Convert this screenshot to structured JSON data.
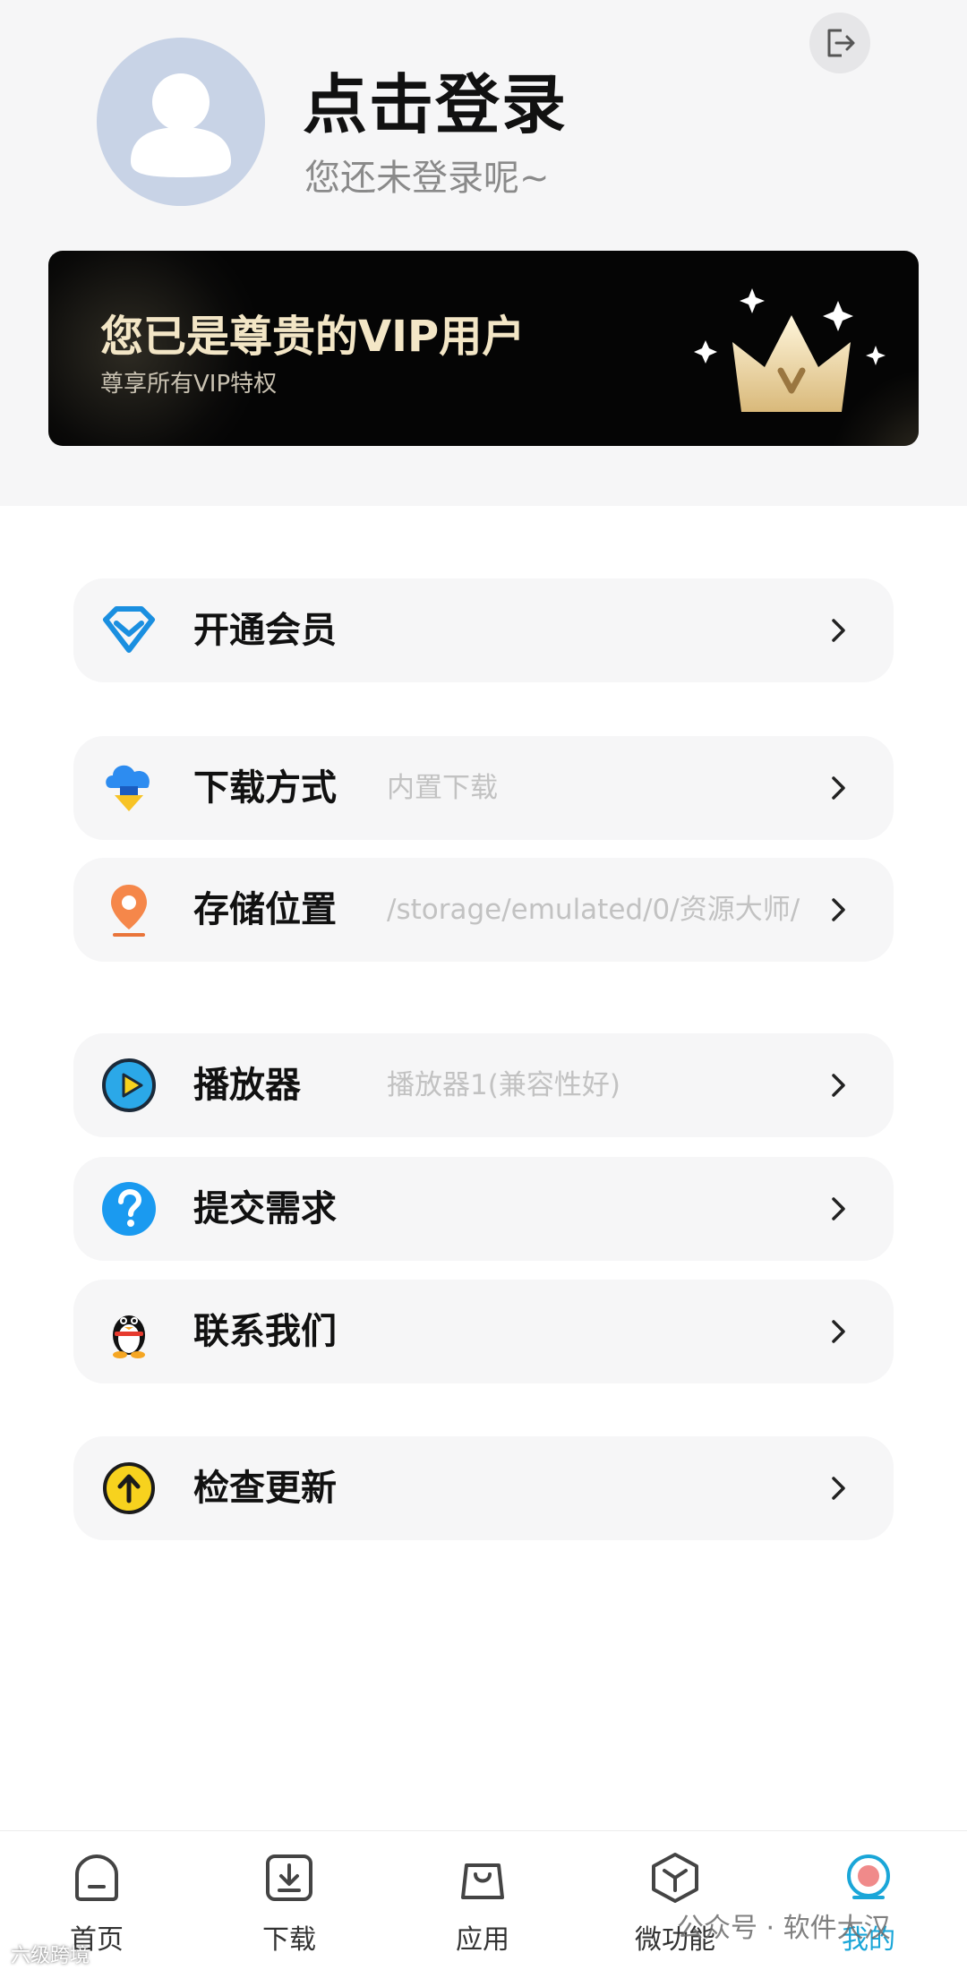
{
  "header": {
    "login_title": "点击登录",
    "login_subtitle": "您还未登录呢~"
  },
  "vip_banner": {
    "title": "您已是尊贵的VIP用户",
    "subtitle": "尊享所有VIP特权"
  },
  "menu": [
    {
      "label": "开通会员",
      "value": "",
      "icon": "diamond-icon"
    },
    {
      "label": "下载方式",
      "value": "内置下载",
      "icon": "cloud-download-icon"
    },
    {
      "label": "存储位置",
      "value": "/storage/emulated/0/资源大师/",
      "icon": "location-pin-icon"
    },
    {
      "label": "播放器",
      "value": "播放器1(兼容性好)",
      "icon": "play-icon"
    },
    {
      "label": "提交需求",
      "value": "",
      "icon": "question-icon"
    },
    {
      "label": "联系我们",
      "value": "",
      "icon": "qq-penguin-icon"
    },
    {
      "label": "检查更新",
      "value": "",
      "icon": "upgrade-arrow-icon"
    }
  ],
  "bottom_nav": [
    {
      "label": "首页",
      "icon": "home-icon"
    },
    {
      "label": "下载",
      "icon": "download-icon"
    },
    {
      "label": "应用",
      "icon": "shopping-bag-icon"
    },
    {
      "label": "微功能",
      "icon": "cube-icon"
    },
    {
      "label": "我的",
      "icon": "profile-icon",
      "active": true
    }
  ],
  "watermark": {
    "left": "六级跨境",
    "right": "公众号 · 软件大汉"
  },
  "colors": {
    "accent": "#1aa6d8",
    "vip_gold": "#f3e6c6",
    "page_bg": "#f6f6f7"
  }
}
